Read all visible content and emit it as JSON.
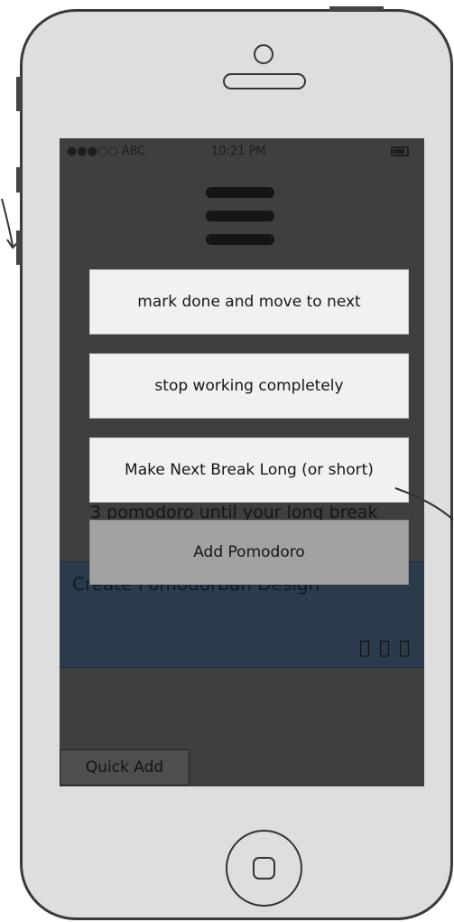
{
  "status_bar": {
    "carrier": "●●●○○ ABC",
    "time": "10:21 PM"
  },
  "menu": {
    "mark_done": "mark done and move to next",
    "stop_working": "stop working completely",
    "next_break": "Make Next Break Long (or short)"
  },
  "overlay": {
    "add_pomodoro": "Add Pomodoro"
  },
  "background": {
    "pomodoros_until_long_break": "3 pomodoro until your long break",
    "task_title": "Create Pomodorbah Design",
    "task_pomodoro_icons": [
      "apple-icon",
      "apple-icon",
      "apple-icon"
    ]
  },
  "footer": {
    "quick_add": "Quick Add"
  },
  "colors": {
    "screen_bg": "#3f3f3f",
    "task_card_bg": "#2b3b4b",
    "menu_button_bg": "#f1f1f1",
    "add_button_bg": "#a2a2a2"
  }
}
